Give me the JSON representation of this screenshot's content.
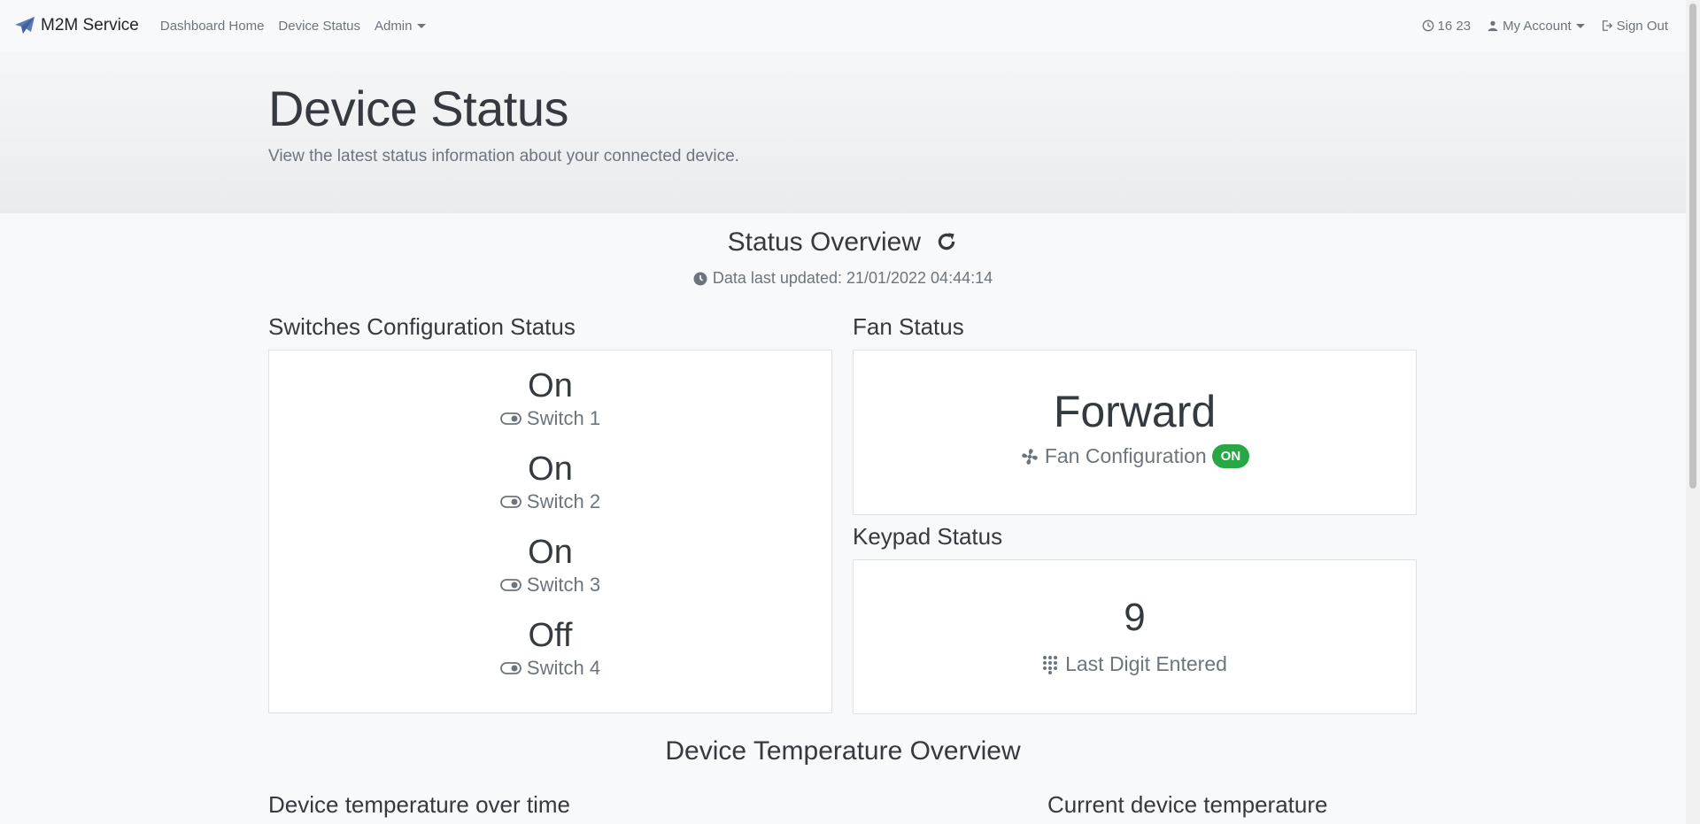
{
  "navbar": {
    "brand": "M2M Service",
    "links": [
      "Dashboard Home",
      "Device Status",
      "Admin"
    ],
    "time": "16 23",
    "account": "My Account",
    "signout": "Sign Out"
  },
  "hero": {
    "title": "Device Status",
    "subtitle": "View the latest status information about your connected device."
  },
  "overview": {
    "title": "Status Overview",
    "updated": "Data last updated: 21/01/2022 04:44:14"
  },
  "switches": {
    "title": "Switches Configuration Status",
    "items": [
      {
        "value": "On",
        "label": "Switch 1"
      },
      {
        "value": "On",
        "label": "Switch 2"
      },
      {
        "value": "On",
        "label": "Switch 3"
      },
      {
        "value": "Off",
        "label": "Switch 4"
      }
    ]
  },
  "fan": {
    "title": "Fan Status",
    "value": "Forward",
    "label": "Fan Configuration",
    "badge": "ON",
    "badge_color": "#28a745"
  },
  "keypad": {
    "title": "Keypad Status",
    "value": "9",
    "label": "Last Digit Entered"
  },
  "temperature": {
    "title": "Device Temperature Overview",
    "over_time": "Device temperature over time",
    "current": "Current device temperature"
  }
}
